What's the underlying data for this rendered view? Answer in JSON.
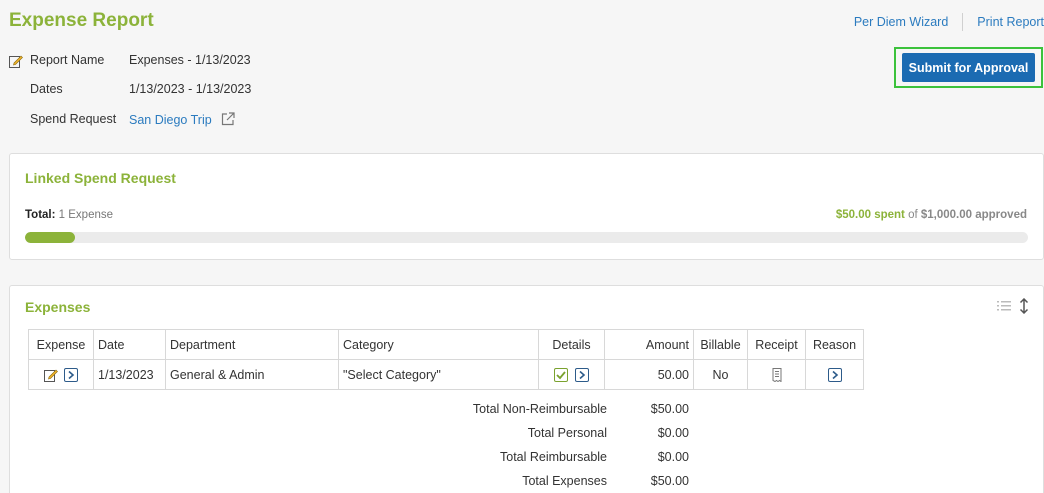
{
  "header": {
    "title": "Expense Report",
    "links": [
      "Per Diem Wizard",
      "Print Report"
    ],
    "submit_label": "Submit for Approval"
  },
  "report": {
    "name_label": "Report Name",
    "name_value": "Expenses - 1/13/2023",
    "dates_label": "Dates",
    "dates_value": "1/13/2023 - 1/13/2023",
    "spend_label": "Spend Request",
    "spend_value": "San Diego Trip"
  },
  "linked": {
    "title": "Linked Spend Request",
    "total_label": "Total:",
    "total_value": "1 Expense",
    "spent": "$50.00 spent",
    "of_text": "of",
    "approved": "$1,000.00 approved",
    "progress_fraction": 0.05,
    "accent": "#8cb33a"
  },
  "expenses": {
    "title": "Expenses",
    "columns": [
      "Expense",
      "Date",
      "Department",
      "Category",
      "Details",
      "Amount",
      "Billable",
      "Receipt",
      "Reason"
    ],
    "row": {
      "date": "1/13/2023",
      "department": "General & Admin",
      "category": "\"Select Category\"",
      "amount": "50.00",
      "billable": "No"
    },
    "totals": [
      {
        "label": "Total Non-Reimbursable",
        "value": "$50.00"
      },
      {
        "label": "Total Personal",
        "value": "$0.00"
      },
      {
        "label": "Total Reimbursable",
        "value": "$0.00"
      },
      {
        "label": "Total Expenses",
        "value": "$50.00"
      }
    ]
  }
}
